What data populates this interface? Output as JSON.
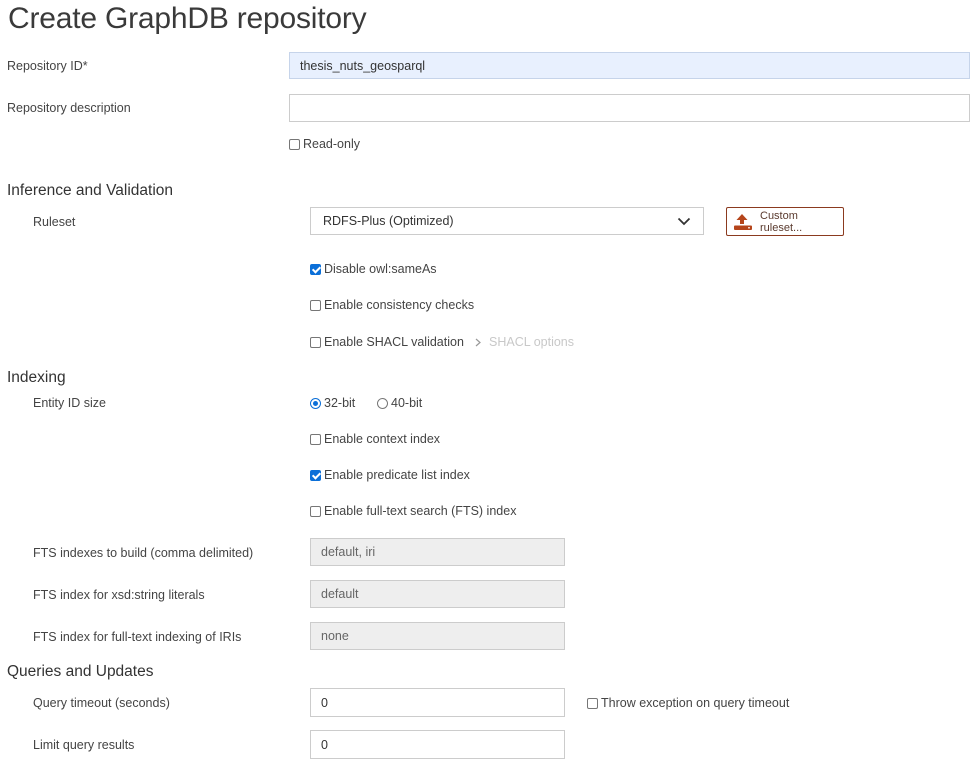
{
  "page": {
    "title": "Create GraphDB repository"
  },
  "general": {
    "repo_id_label": "Repository ID*",
    "repo_id_value": "thesis_nuts_geosparql",
    "repo_desc_label": "Repository description",
    "repo_desc_value": "",
    "read_only_label": "Read-only",
    "read_only_checked": false
  },
  "inference": {
    "heading": "Inference and Validation",
    "ruleset_label": "Ruleset",
    "ruleset_value": "RDFS-Plus (Optimized)",
    "custom_ruleset_label": "Custom ruleset...",
    "disable_sameas_label": "Disable owl:sameAs",
    "disable_sameas_checked": true,
    "consistency_label": "Enable consistency checks",
    "consistency_checked": false,
    "shacl_label": "Enable SHACL validation",
    "shacl_checked": false,
    "shacl_options_label": "SHACL options"
  },
  "indexing": {
    "heading": "Indexing",
    "entity_id_label": "Entity ID size",
    "opt_32": "32-bit",
    "opt_40": "40-bit",
    "selected": "32-bit",
    "context_index_label": "Enable context index",
    "context_index_checked": false,
    "predicate_list_label": "Enable predicate list index",
    "predicate_list_checked": true,
    "fts_label": "Enable full-text search (FTS) index",
    "fts_checked": false,
    "fts_build_label": "FTS indexes to build (comma delimited)",
    "fts_build_value": "default, iri",
    "fts_string_label": "FTS index for xsd:string literals",
    "fts_string_value": "default",
    "fts_iri_label": "FTS index for full-text indexing of IRIs",
    "fts_iri_value": "none"
  },
  "queries": {
    "heading": "Queries and Updates",
    "timeout_label": "Query timeout (seconds)",
    "timeout_value": "0",
    "throw_label": "Throw exception on query timeout",
    "throw_checked": false,
    "limit_label": "Limit query results",
    "limit_value": "0"
  },
  "colors": {
    "accent": "#0b6fd8",
    "custom_button_border": "#8b3a1f",
    "upload_icon": "#b5451b",
    "filled_input": "#e8f0fe",
    "disabled_input": "#eeeeee"
  },
  "icons": {
    "upload": "upload-icon",
    "chevron_down": "chevron-down-icon",
    "chevron_right": "chevron-right-icon"
  }
}
